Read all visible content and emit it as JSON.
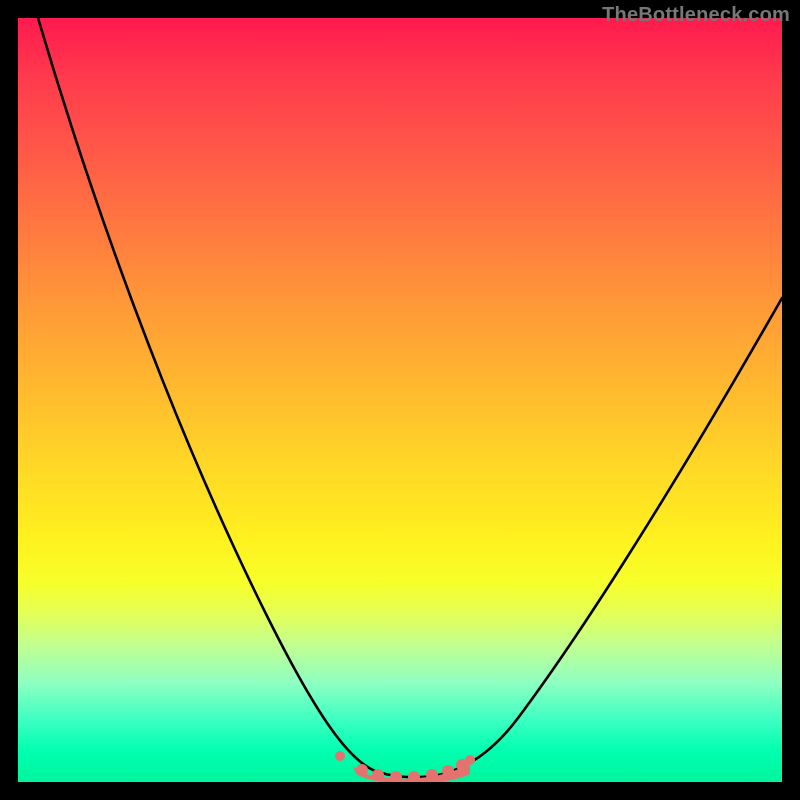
{
  "watermark": "TheBottleneck.com",
  "chart_data": {
    "type": "line",
    "title": "",
    "xlabel": "",
    "ylabel": "",
    "xlim": [
      0,
      100
    ],
    "ylim": [
      0,
      100
    ],
    "series": [
      {
        "name": "bottleneck-curve",
        "x": [
          0,
          5,
          10,
          15,
          20,
          25,
          30,
          35,
          40,
          43,
          45,
          47,
          50,
          53,
          55,
          57,
          60,
          65,
          70,
          75,
          80,
          85,
          90,
          95,
          100
        ],
        "y": [
          100,
          90,
          80,
          70,
          60,
          50,
          40,
          30,
          20,
          10,
          5,
          2,
          1,
          1,
          2,
          4,
          8,
          15,
          23,
          31,
          39,
          47,
          55,
          62,
          68
        ]
      }
    ],
    "markers": {
      "name": "flat-region-dots",
      "color": "#e4736f",
      "x": [
        43,
        45,
        47,
        49,
        51,
        53,
        55,
        57
      ],
      "y": [
        4,
        2,
        1,
        1,
        1,
        1,
        2,
        3
      ]
    },
    "colors": {
      "curve": "#000000",
      "markers": "#e4736f",
      "background_top": "#ff1a4d",
      "background_bottom": "#00f59c",
      "frame": "#000000"
    }
  }
}
